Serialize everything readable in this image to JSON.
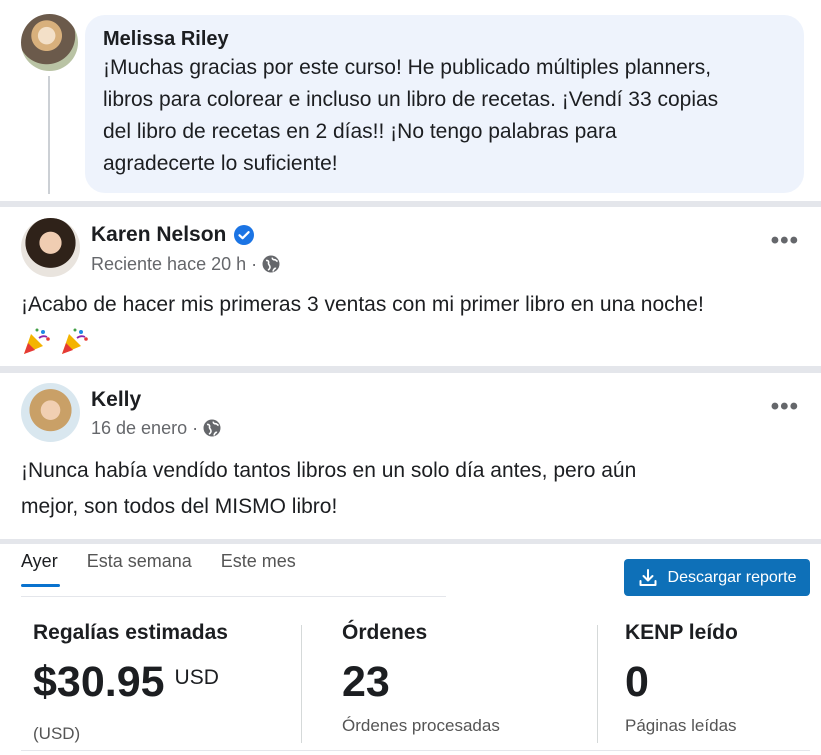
{
  "comment": {
    "author": "Melissa Riley",
    "lines": [
      "¡Muchas gracias por este curso! He publicado múltiples planners,",
      "libros para colorear e incluso un libro de recetas. ¡Vendí 33 copias",
      "del libro de recetas en 2 días!! ¡No tengo palabras para",
      "agradecerte lo suficiente!"
    ]
  },
  "posts": [
    {
      "author": "Karen Nelson",
      "verified": true,
      "meta": "Reciente hace 20 h",
      "dot": "·",
      "text": "¡Acabo de hacer mis primeras 3 ventas con mi primer libro en una noche!",
      "emojis": [
        "party-popper",
        "party-popper"
      ],
      "more": "•••"
    },
    {
      "author": "Kelly",
      "verified": false,
      "meta": "16 de enero",
      "dot": "·",
      "text_lines": [
        "¡Nunca había vendído tantos libros en un solo día antes, pero aún",
        "mejor, son todos del MISMO libro!"
      ],
      "more": "•••"
    }
  ],
  "dashboard": {
    "tabs": [
      "Ayer",
      "Esta semana",
      "Este mes"
    ],
    "active_tab": "Ayer",
    "download_button": "Descargar reporte",
    "metrics": [
      {
        "label": "Regalías estimadas",
        "value": "$30.95",
        "unit": "USD",
        "sub": "(USD)"
      },
      {
        "label": "Órdenes",
        "value": "23",
        "unit": "",
        "sub": "Órdenes procesadas"
      },
      {
        "label": "KENP leído",
        "value": "0",
        "unit": "",
        "sub": "Páginas leídas"
      }
    ],
    "colors": {
      "accent": "#0972ce",
      "button": "#0e70b8"
    }
  },
  "colors": {
    "bubble": "#eef3fc",
    "verified": "#1b74e4",
    "meta_text": "#65676b"
  }
}
